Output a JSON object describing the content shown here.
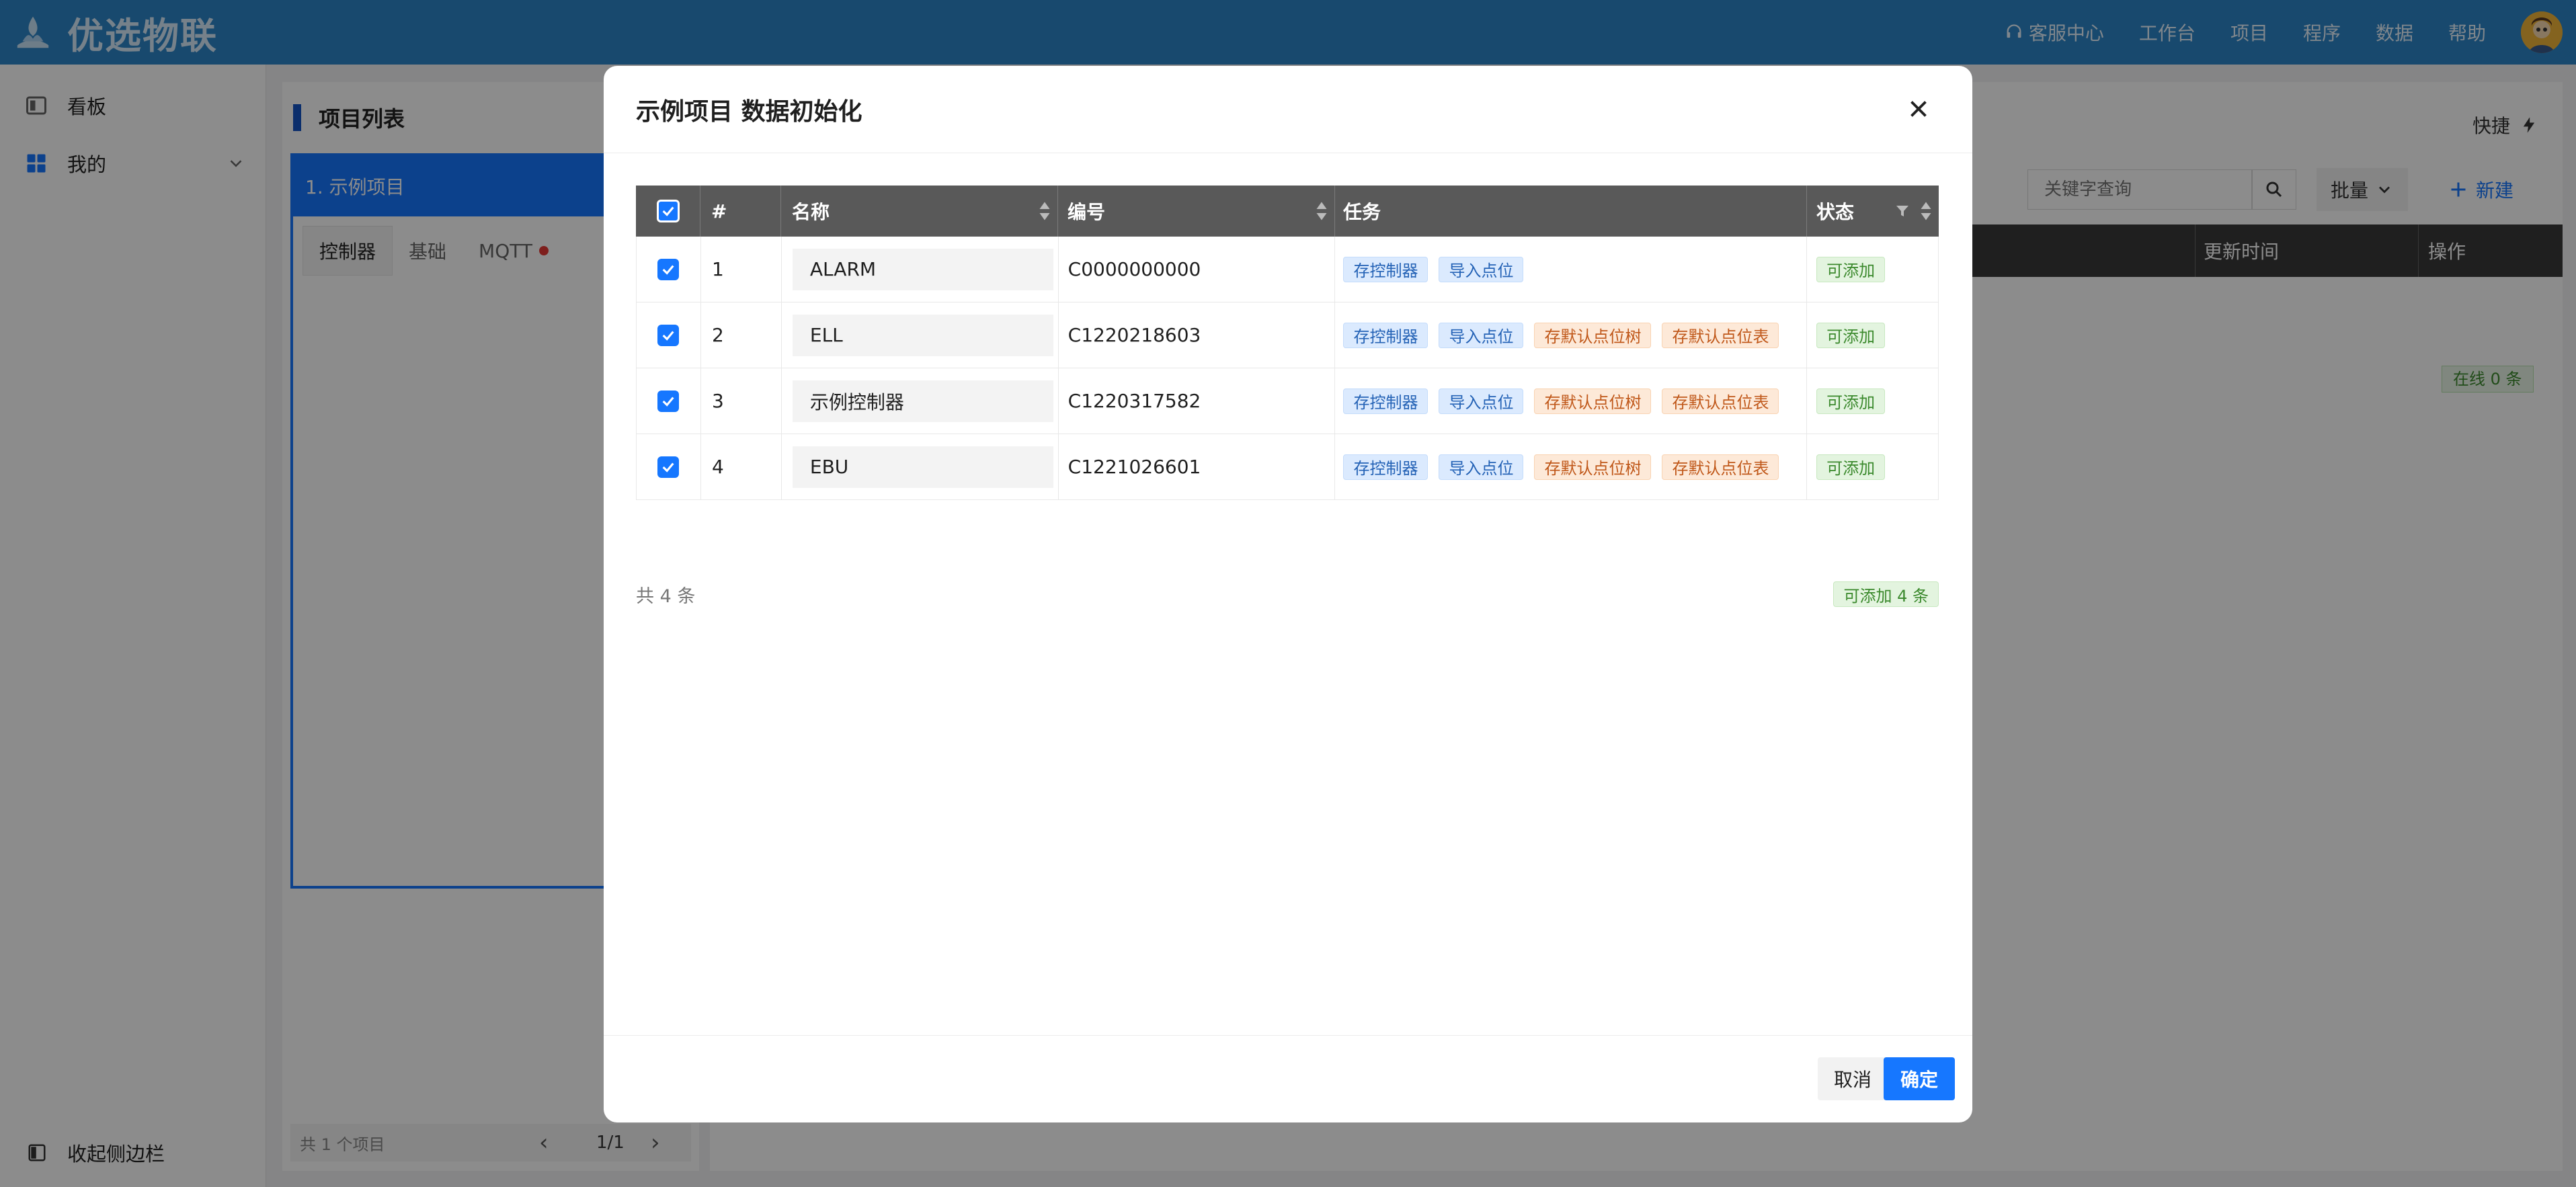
{
  "app": {
    "title": "优选物联"
  },
  "topnav": {
    "support": "客服中心",
    "items": [
      "工作台",
      "项目",
      "程序",
      "数据",
      "帮助"
    ]
  },
  "sidebar": {
    "items": [
      {
        "label": "看板",
        "icon": "board-icon"
      },
      {
        "label": "我的",
        "icon": "grid-icon"
      }
    ],
    "collapse_label": "收起侧边栏"
  },
  "project_list": {
    "title": "项目列表",
    "selected": "1. 示例项目",
    "tabs": [
      "控制器",
      "基础",
      "MQTT"
    ],
    "active_tab": "控制器",
    "pager_total": "共 1 个项目",
    "pager_page": "1/1"
  },
  "main": {
    "quick_label": "快捷",
    "search_placeholder": "关键字查询",
    "batch_label": "批量",
    "new_label": "新建",
    "columns": [
      "更新时间",
      "操作"
    ],
    "online_badge": "在线 0 条"
  },
  "modal": {
    "title": "示例项目 数据初始化",
    "columns": {
      "idx": "#",
      "name": "名称",
      "code": "编号",
      "task": "任务",
      "status": "状态"
    },
    "rows": [
      {
        "idx": "1",
        "name": "ALARM",
        "code": "C0000000000",
        "tasks": [
          {
            "label": "存控制器",
            "tone": "blue"
          },
          {
            "label": "导入点位",
            "tone": "blue"
          }
        ],
        "status": "可添加"
      },
      {
        "idx": "2",
        "name": "ELL",
        "code": "C1220218603",
        "tasks": [
          {
            "label": "存控制器",
            "tone": "blue"
          },
          {
            "label": "导入点位",
            "tone": "blue"
          },
          {
            "label": "存默认点位树",
            "tone": "orange"
          },
          {
            "label": "存默认点位表",
            "tone": "orange"
          }
        ],
        "status": "可添加"
      },
      {
        "idx": "3",
        "name": "示例控制器",
        "code": "C1220317582",
        "tasks": [
          {
            "label": "存控制器",
            "tone": "blue"
          },
          {
            "label": "导入点位",
            "tone": "blue"
          },
          {
            "label": "存默认点位树",
            "tone": "orange"
          },
          {
            "label": "存默认点位表",
            "tone": "orange"
          }
        ],
        "status": "可添加"
      },
      {
        "idx": "4",
        "name": "EBU",
        "code": "C1221026601",
        "tasks": [
          {
            "label": "存控制器",
            "tone": "blue"
          },
          {
            "label": "导入点位",
            "tone": "blue"
          },
          {
            "label": "存默认点位树",
            "tone": "orange"
          },
          {
            "label": "存默认点位表",
            "tone": "orange"
          }
        ],
        "status": "可添加"
      }
    ],
    "total": "共 4 条",
    "addable": "可添加 4 条",
    "cancel_label": "取消",
    "ok_label": "确定"
  },
  "colors": {
    "header": "#2d86c8",
    "primary": "#1677ff",
    "table_head": "#595959"
  }
}
